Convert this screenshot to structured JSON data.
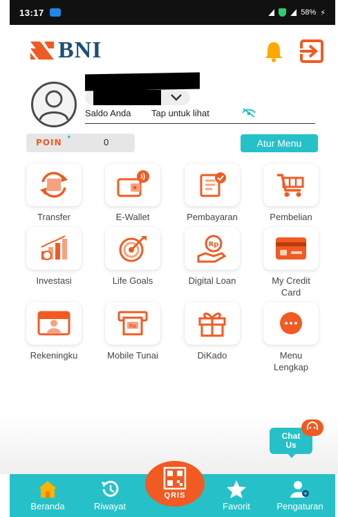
{
  "status_bar": {
    "time": "13:17",
    "battery": "58%"
  },
  "header": {
    "brand": "BNI"
  },
  "profile": {
    "saldo_label": "Saldo Anda",
    "tap_label": "Tap untuk lihat"
  },
  "poin": {
    "logo": "POIN",
    "value": "0"
  },
  "atur_menu": "Atur Menu",
  "menu": [
    {
      "label": "Transfer",
      "icon": "transfer-icon"
    },
    {
      "label": "E-Wallet",
      "icon": "wallet-icon"
    },
    {
      "label": "Pembayaran",
      "icon": "bill-payment-icon"
    },
    {
      "label": "Pembelian",
      "icon": "shopping-cart-icon"
    },
    {
      "label": "Investasi",
      "icon": "investment-chart-icon"
    },
    {
      "label": "Life Goals",
      "icon": "target-icon"
    },
    {
      "label": "Digital Loan",
      "icon": "loan-hand-coin-icon"
    },
    {
      "label": "My Credit\nCard",
      "icon": "credit-card-icon"
    },
    {
      "label": "Rekeningku",
      "icon": "account-card-icon"
    },
    {
      "label": "Mobile Tunai",
      "icon": "cash-withdraw-icon"
    },
    {
      "label": "DiKado",
      "icon": "gift-icon"
    },
    {
      "label": "Menu\nLengkap",
      "icon": "more-dots-icon"
    }
  ],
  "chat": {
    "label": "Chat\nUs"
  },
  "bottom_nav": {
    "beranda": "Beranda",
    "riwayat": "Riwayat",
    "qris": "QRIS",
    "favorit": "Favorit",
    "pengaturan": "Pengaturan"
  },
  "colors": {
    "orange": "#f15a22",
    "teal": "#26c1c8",
    "navy": "#1a4f7a"
  }
}
